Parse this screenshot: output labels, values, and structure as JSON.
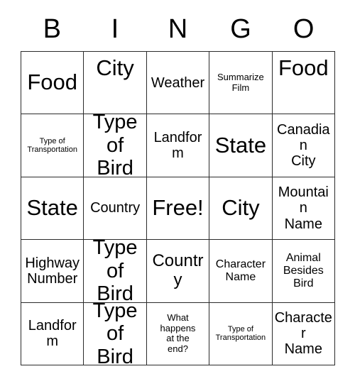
{
  "card": {
    "title_letters": [
      "B",
      "I",
      "N",
      "G",
      "O"
    ],
    "grid_size": 5,
    "free_space_label": "Free!",
    "border_color": "#2b2b2b",
    "background_color": "#ffffff",
    "text_color": "#000000"
  },
  "rows": [
    [
      {
        "label": "Food",
        "size": "fs-xxl",
        "align": "va-center"
      },
      {
        "label": "City",
        "size": "fs-xxl",
        "align": "va-top"
      },
      {
        "label": "Weather",
        "size": "fs-md",
        "align": "va-center"
      },
      {
        "label": "Summarize\nFilm",
        "size": "fs-xs",
        "align": "va-center"
      },
      {
        "label": "Food",
        "size": "fs-xxl",
        "align": "va-top"
      }
    ],
    [
      {
        "label": "Type of\nTransportation",
        "size": "fs-xxs",
        "align": "va-center"
      },
      {
        "label": "Type\nof Bird",
        "size": "fs-xl",
        "align": "va-center"
      },
      {
        "label": "Landform",
        "size": "fs-md",
        "align": "va-center"
      },
      {
        "label": "State",
        "size": "fs-xxl",
        "align": "va-center"
      },
      {
        "label": "Canadian\nCity",
        "size": "fs-md",
        "align": "va-center"
      }
    ],
    [
      {
        "label": "State",
        "size": "fs-xxl",
        "align": "va-center"
      },
      {
        "label": "Country",
        "size": "fs-md",
        "align": "va-center"
      },
      {
        "label": "Free!",
        "size": "fs-xxl",
        "align": "va-center"
      },
      {
        "label": "City",
        "size": "fs-xxl",
        "align": "va-center"
      },
      {
        "label": "Mountain\nName",
        "size": "fs-md",
        "align": "va-center"
      }
    ],
    [
      {
        "label": "Highway\nNumber",
        "size": "fs-md",
        "align": "va-center"
      },
      {
        "label": "Type\nof Bird",
        "size": "fs-xl",
        "align": "va-center"
      },
      {
        "label": "Country",
        "size": "fs-lg",
        "align": "va-center"
      },
      {
        "label": "Character\nName",
        "size": "fs-sm",
        "align": "va-center"
      },
      {
        "label": "Animal\nBesides\nBird",
        "size": "fs-sm",
        "align": "va-center"
      }
    ],
    [
      {
        "label": "Landform",
        "size": "fs-md",
        "align": "va-center"
      },
      {
        "label": "Type\nof Bird",
        "size": "fs-xl",
        "align": "va-center"
      },
      {
        "label": "What\nhappens\nat the\nend?",
        "size": "fs-xs",
        "align": "va-center"
      },
      {
        "label": "Type of\nTransportation",
        "size": "fs-xxs",
        "align": "va-center"
      },
      {
        "label": "Character\nName",
        "size": "fs-md",
        "align": "va-center"
      }
    ]
  ]
}
